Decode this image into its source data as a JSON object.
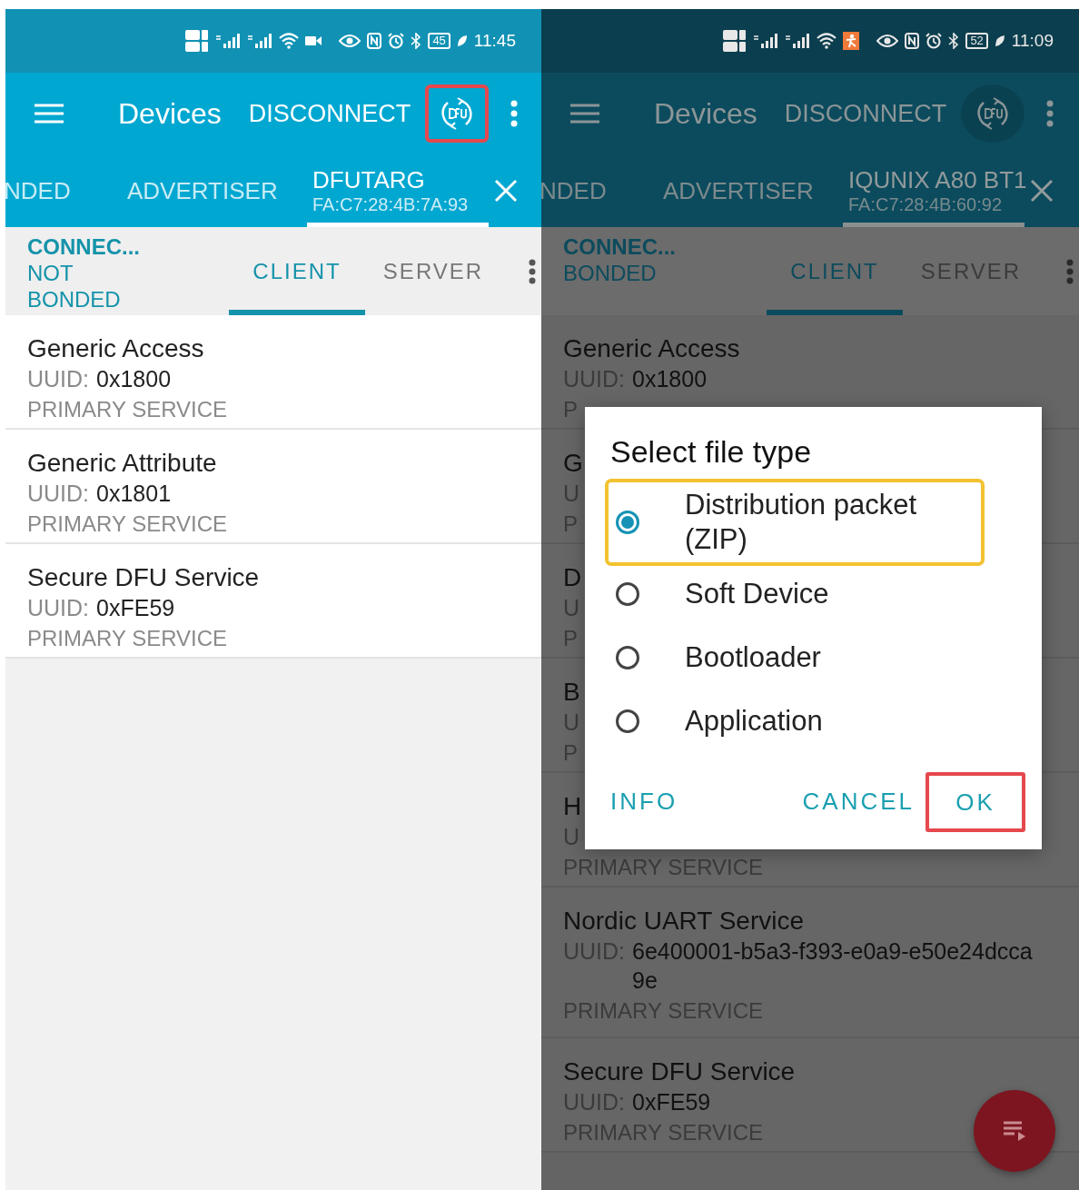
{
  "panels": [
    {
      "dimmed": false,
      "status_bar": {
        "notification": {
          "kind": "video"
        },
        "battery": "45",
        "time": "11:45"
      },
      "app_bar": {
        "title": "Devices",
        "action": "DISCONNECT",
        "dfu_highlighted": true
      },
      "tabs": [
        {
          "label": "NDED",
          "selected": false
        },
        {
          "label": "ADVERTISER",
          "selected": false
        },
        {
          "label": "DFUTARG",
          "address": "FA:C7:28:4B:7A:93",
          "selected": true
        }
      ],
      "connection": {
        "state": "CONNEC...",
        "bond": "NOT BONDED"
      },
      "subtabs": [
        {
          "label": "CLIENT",
          "selected": true
        },
        {
          "label": "SERVER",
          "selected": false
        }
      ],
      "services": [
        {
          "name": "Generic Access",
          "uuid_label": "UUID:",
          "uuid": "0x1800",
          "type": "PRIMARY SERVICE"
        },
        {
          "name": "Generic Attribute",
          "uuid_label": "UUID:",
          "uuid": "0x1801",
          "type": "PRIMARY SERVICE"
        },
        {
          "name": "Secure DFU Service",
          "uuid_label": "UUID:",
          "uuid": "0xFE59",
          "type": "PRIMARY SERVICE"
        }
      ]
    },
    {
      "dimmed": true,
      "status_bar": {
        "notification": {
          "kind": "app"
        },
        "battery": "52",
        "time": "11:09"
      },
      "app_bar": {
        "title": "Devices",
        "action": "DISCONNECT",
        "dfu_highlighted": false
      },
      "tabs": [
        {
          "label": "NDED",
          "selected": false
        },
        {
          "label": "ADVERTISER",
          "selected": false
        },
        {
          "label": "IQUNIX A80 BT1",
          "address": "FA:C7:28:4B:60:92",
          "selected": true
        }
      ],
      "connection": {
        "state": "CONNEC...",
        "bond": "BONDED"
      },
      "subtabs": [
        {
          "label": "CLIENT",
          "selected": true
        },
        {
          "label": "SERVER",
          "selected": false
        }
      ],
      "services": [
        {
          "name": "Generic Access",
          "uuid_label": "UUID:",
          "uuid": "0x1800",
          "type": "P"
        },
        {
          "name": "G",
          "uuid_label": "U",
          "type": "P"
        },
        {
          "name": "D",
          "uuid_label": "U",
          "type": "P"
        },
        {
          "name": "B",
          "uuid_label": "U",
          "type": "P"
        },
        {
          "name": "H",
          "uuid_label": "U",
          "type": "PRIMARY SERVICE"
        },
        {
          "name": "Nordic UART Service",
          "uuid_label": "UUID:",
          "uuid": "6e400001-b5a3-f393-e0a9-e50e24dcca9e",
          "type": "PRIMARY SERVICE"
        },
        {
          "name": "Secure DFU Service",
          "uuid_label": "UUID:",
          "uuid": "0xFE59",
          "type": "PRIMARY SERVICE"
        }
      ],
      "dialog": {
        "title": "Select file type",
        "options": [
          {
            "label": "Distribution packet (ZIP)",
            "selected": true,
            "highlighted": true
          },
          {
            "label": "Soft Device",
            "selected": false,
            "highlighted": false
          },
          {
            "label": "Bootloader",
            "selected": false,
            "highlighted": false
          },
          {
            "label": "Application",
            "selected": false,
            "highlighted": false
          }
        ],
        "buttons": [
          {
            "label": "INFO",
            "highlighted": false
          },
          {
            "label": "CANCEL",
            "highlighted": false
          },
          {
            "label": "OK",
            "highlighted": true
          }
        ]
      },
      "fab": {
        "shown": true
      }
    }
  ]
}
